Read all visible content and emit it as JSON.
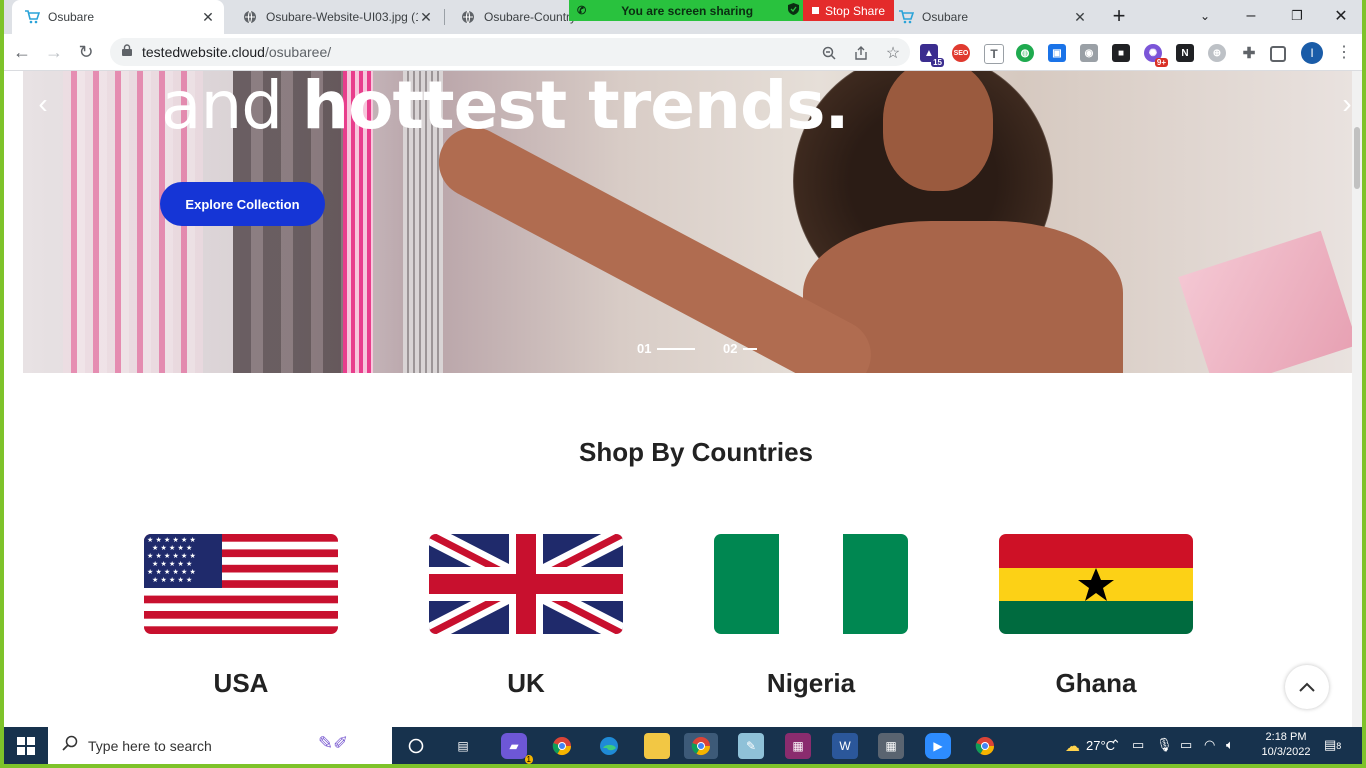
{
  "browser": {
    "tabs": [
      {
        "title": "Osubare",
        "active": true,
        "favicon": "cart-icon"
      },
      {
        "title": "Osubare-Website-UI03.jpg (1",
        "active": false,
        "favicon": "globe-icon"
      },
      {
        "title": "Osubare-Country",
        "active": false,
        "favicon": "globe-icon"
      },
      {
        "title": "Osubare",
        "active": false,
        "favicon": "cart-icon"
      }
    ],
    "share_banner": "You are screen sharing",
    "stop_share": "Stop Share",
    "url_host": "testedwebsite.cloud",
    "url_path": "/osubaree/",
    "extensions": {
      "ext1_badge": "15",
      "ext2_label": "SEO",
      "ext3_label": "T",
      "ext4_badge": "9+"
    },
    "profile_initial": "I"
  },
  "hero": {
    "title_light": "and",
    "title_bold": "hottest trends.",
    "cta": "Explore Collection",
    "slides": [
      "01",
      "02"
    ]
  },
  "countries_section": {
    "title": "Shop By Countries",
    "countries": [
      {
        "name": "USA"
      },
      {
        "name": "UK"
      },
      {
        "name": "Nigeria"
      },
      {
        "name": "Ghana"
      }
    ]
  },
  "taskbar": {
    "search_placeholder": "Type here to search",
    "temperature": "27°C",
    "time": "2:18 PM",
    "date": "10/3/2022",
    "notification_count": "8",
    "teams_badge": "1"
  },
  "colors": {
    "accent_button": "#1535d6",
    "share_green": "#29c23e",
    "stop_red": "#e42b2b"
  }
}
